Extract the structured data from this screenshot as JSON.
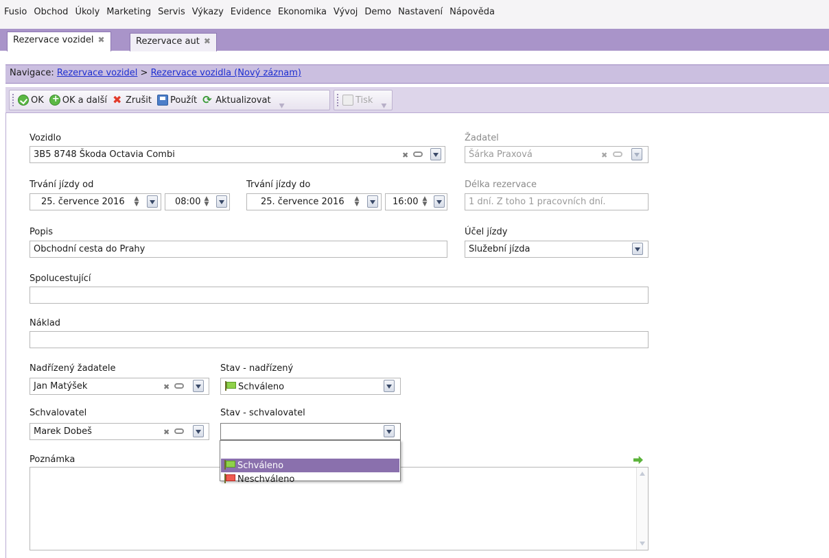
{
  "menu": [
    "Fusio",
    "Obchod",
    "Úkoly",
    "Marketing",
    "Servis",
    "Výkazy",
    "Evidence",
    "Ekonomika",
    "Vývoj",
    "Demo",
    "Nastavení",
    "Nápověda"
  ],
  "tabs": [
    {
      "label": "Rezervace vozidel",
      "close": "✖",
      "active": true
    },
    {
      "label": "Rezervace aut",
      "close": "✖",
      "active": false
    }
  ],
  "navigation": {
    "label": "Navigace:",
    "link1": "Rezervace vozidel",
    "separator": ">",
    "link2": "Rezervace vozidla (Nový záznam)"
  },
  "toolbar": {
    "ok": "OK",
    "ok_next": "OK a další",
    "cancel": "Zrušit",
    "apply": "Použít",
    "refresh": "Aktualizovat",
    "print": "Tisk"
  },
  "form": {
    "vehicle": {
      "label": "Vozidlo",
      "value": "3B5 8748 Škoda Octavia Combi"
    },
    "requester": {
      "label": "Žadatel",
      "value": "Šárka Praxová"
    },
    "from": {
      "label": "Trvání jízdy od",
      "date": "25. července 2016",
      "time": "08:00"
    },
    "to": {
      "label": "Trvání jízdy do",
      "date": "25. července 2016",
      "time": "16:00"
    },
    "length": {
      "label": "Délka rezervace",
      "value": "1 dní. Z toho 1 pracovních dní."
    },
    "description": {
      "label": "Popis",
      "value": "Obchodní cesta do Prahy"
    },
    "purpose": {
      "label": "Účel jízdy",
      "value": "Služební jízda"
    },
    "passengers": {
      "label": "Spolucestující",
      "value": ""
    },
    "cost": {
      "label": "Náklad",
      "value": ""
    },
    "supervisor": {
      "label": "Nadřízený žadatele",
      "value": "Jan Matýšek"
    },
    "supervisor_state": {
      "label": "Stav - nadřízený",
      "value": "Schváleno"
    },
    "approver": {
      "label": "Schvalovatel",
      "value": "Marek Dobeš"
    },
    "approver_state": {
      "label": "Stav - schvalovatel",
      "value": ""
    },
    "note": {
      "label": "Poznámka",
      "value": ""
    }
  },
  "dropdown_options": [
    {
      "label": "Schváleno",
      "flag": "green",
      "selected": true
    },
    {
      "label": "Neschváleno",
      "flag": "red",
      "selected": false
    }
  ],
  "colors": {
    "tab_bar": "#a994c9",
    "nav_bar": "#cbbfe0",
    "toolbar": "#ddd5ea",
    "selection": "#8a70ad",
    "link": "#1e2fd0"
  }
}
